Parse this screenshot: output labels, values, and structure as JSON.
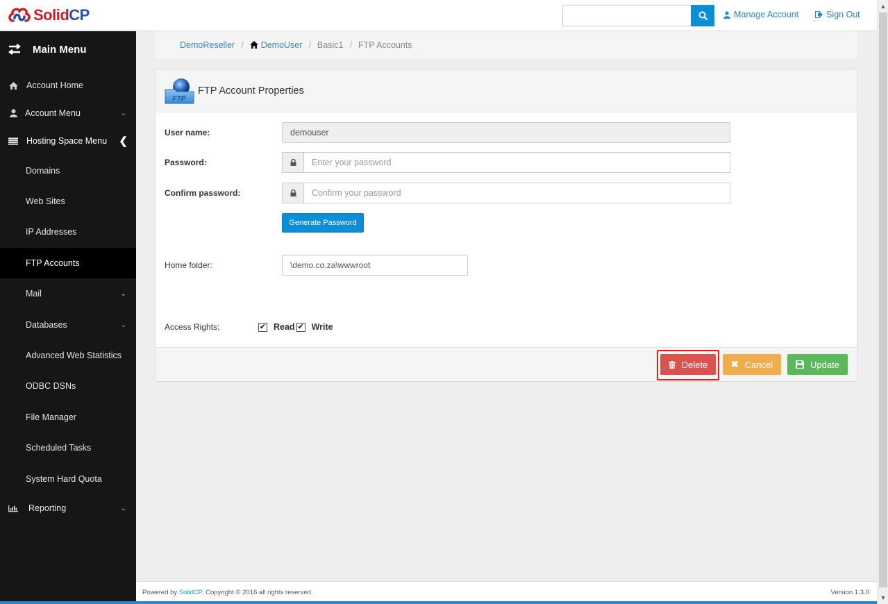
{
  "brand": {
    "name_part1": "Solid",
    "name_part2": "CP"
  },
  "topbar": {
    "search_placeholder": "",
    "search_value": "",
    "manage_account": "Manage Account",
    "sign_out": "Sign Out"
  },
  "sidebar": {
    "header": "Main Menu",
    "items": [
      {
        "label": "Account Home",
        "icon": "home-icon"
      },
      {
        "label": "Account Menu",
        "icon": "user-icon",
        "chevron": "down"
      },
      {
        "label": "Hosting Space Menu",
        "icon": "list-icon",
        "chevron": "left"
      },
      {
        "label": "Domains"
      },
      {
        "label": "Web Sites"
      },
      {
        "label": "IP Addresses"
      },
      {
        "label": "FTP Accounts",
        "active": true
      },
      {
        "label": "Mail",
        "chevron": "down"
      },
      {
        "label": "Databases",
        "chevron": "down"
      },
      {
        "label": "Advanced Web Statistics"
      },
      {
        "label": "ODBC DSNs"
      },
      {
        "label": "File Manager"
      },
      {
        "label": "Scheduled Tasks"
      },
      {
        "label": "System Hard Quota"
      },
      {
        "label": "Reporting",
        "icon": "bar-chart-icon",
        "chevron": "down"
      }
    ]
  },
  "breadcrumb": {
    "items": [
      "DemoReseller",
      "DemoUser",
      "Basic1",
      "FTP Accounts"
    ],
    "separator": "/"
  },
  "panel": {
    "title": "FTP Account Properties",
    "icon_text": "FTP",
    "fields": {
      "username_label": "User name:",
      "username_value": "demouser",
      "password_label": "Password:",
      "password_placeholder": "Enter your password",
      "confirm_label": "Confirm password:",
      "confirm_placeholder": "Confirm your password",
      "generate_button": "Generate Password",
      "home_label": "Home folder:",
      "home_value": "\\demo.co.za\\wwwroot",
      "access_label": "Access Rights:",
      "read_label": "Read",
      "read_checked": true,
      "write_label": "Write",
      "write_checked": true
    },
    "buttons": {
      "delete": "Delete",
      "cancel": "Cancel",
      "update": "Update"
    }
  },
  "footer": {
    "powered_prefix": "Powered by ",
    "powered_brand": "SolidCP",
    "copyright": ". Copyright © 2016 all rights reserved.",
    "version": "Version 1.3.0"
  },
  "colors": {
    "primary": "#0b8ed6",
    "danger": "#d9534f",
    "warning": "#f0ad4e",
    "success": "#5cb85c",
    "sidebar_bg": "#161616",
    "highlight": "#e41b17"
  }
}
